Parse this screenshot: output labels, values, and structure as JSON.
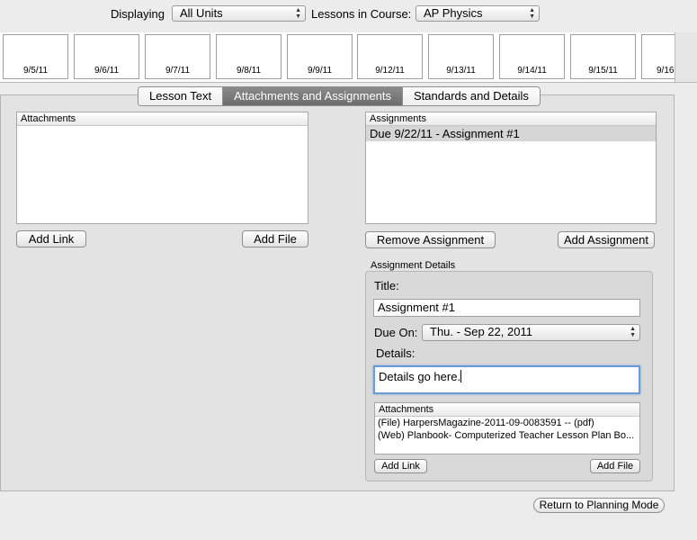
{
  "toolbar": {
    "displaying_label": "Displaying",
    "displaying_value": "All Units",
    "course_label": "Lessons in Course:",
    "course_value": "AP Physics"
  },
  "dates": [
    "9/5/11",
    "9/6/11",
    "9/7/11",
    "9/8/11",
    "9/9/11",
    "9/12/11",
    "9/13/11",
    "9/14/11",
    "9/15/11",
    "9/16"
  ],
  "tabs": [
    "Lesson Text",
    "Attachments and Assignments",
    "Standards and Details"
  ],
  "active_tab": 1,
  "attachments": {
    "header": "Attachments",
    "add_link": "Add Link",
    "add_file": "Add File"
  },
  "assignments": {
    "header": "Assignments",
    "items": [
      "Due 9/22/11 - Assignment #1"
    ],
    "remove": "Remove Assignment",
    "add": "Add Assignment"
  },
  "details": {
    "group_label": "Assignment Details",
    "title_label": "Title:",
    "title_value": "Assignment #1",
    "due_label": "Due On:",
    "due_value": "Thu. - Sep 22, 2011",
    "details_label": "Details:",
    "details_value": "Details go here.",
    "attachments_header": "Attachments",
    "attachments_items": [
      "(File) HarpersMagazine-2011-09-0083591 -- (pdf)",
      "(Web) Planbook- Computerized Teacher Lesson Plan Bo..."
    ],
    "add_link": "Add Link",
    "add_file": "Add File"
  },
  "footer": {
    "return_button": "Return to Planning Mode"
  }
}
